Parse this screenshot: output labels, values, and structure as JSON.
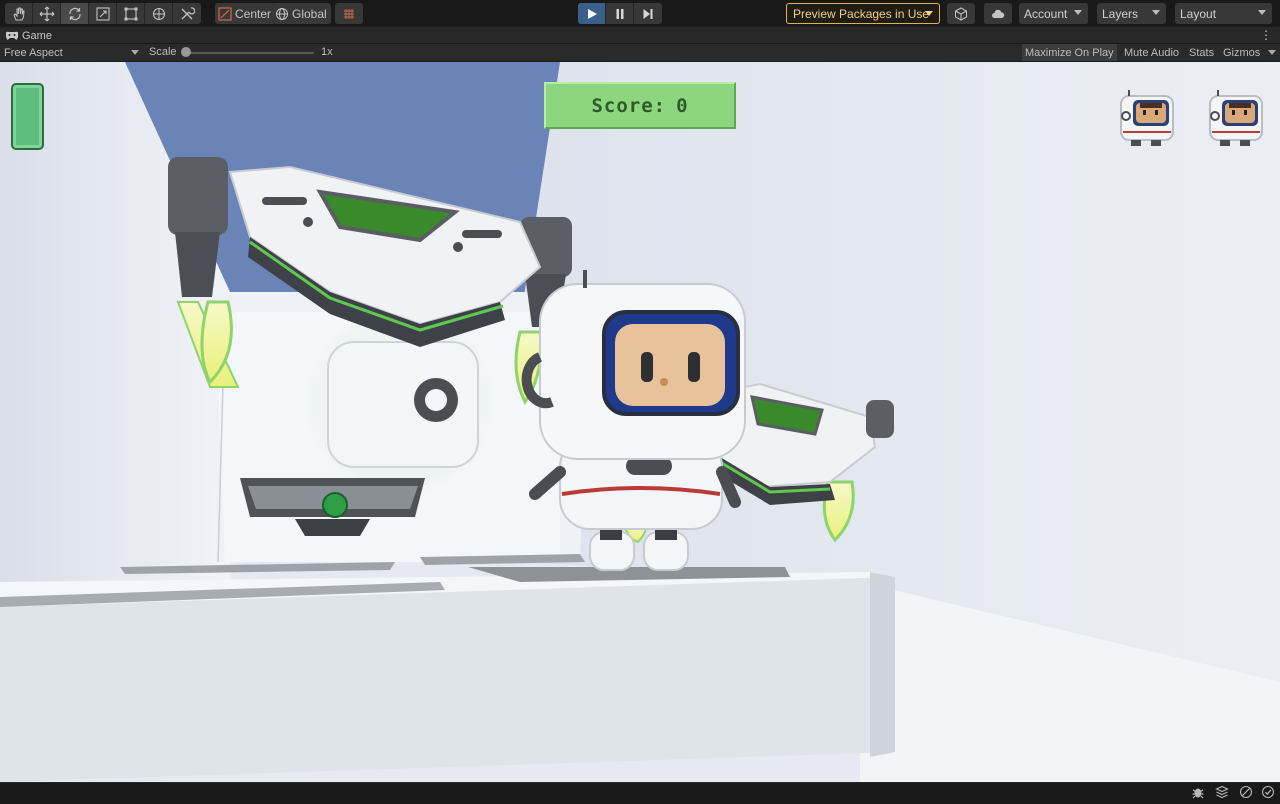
{
  "toolbar": {
    "tools": [
      {
        "icon": "hand-tool-icon"
      },
      {
        "icon": "move-tool-icon"
      },
      {
        "icon": "rotate-tool-icon",
        "active": true
      },
      {
        "icon": "scale-tool-icon"
      },
      {
        "icon": "rect-tool-icon"
      },
      {
        "icon": "transform-tool-icon"
      },
      {
        "icon": "custom-tools-icon"
      }
    ],
    "pivot_mode": "Center",
    "pivot_rotation": "Global",
    "snap_icon": "grid-snap-icon",
    "playback": {
      "play": "play-icon",
      "pause": "pause-icon",
      "step": "step-icon",
      "playing": true
    },
    "preview_packages": "Preview Packages in Use",
    "account": "Account",
    "layers": "Layers",
    "layout": "Layout"
  },
  "tab": {
    "title": "Game",
    "icon": "gamepad-icon"
  },
  "game_bar": {
    "aspect": "Free Aspect",
    "scale_label": "Scale",
    "scale_value": "1x",
    "scale_level": 0.0,
    "maximize": "Maximize On Play",
    "mute": "Mute Audio",
    "stats": "Stats",
    "gizmos": "Gizmos"
  },
  "hud": {
    "score_label": "Score:",
    "score_value": "0",
    "health_level": 1.0,
    "lives": 2
  },
  "colors": {
    "accent_preview": "#e0b44a",
    "play_active": "#3a5f8a",
    "hud_green": "#8cd77e",
    "health_green": "#5fbe7e"
  }
}
